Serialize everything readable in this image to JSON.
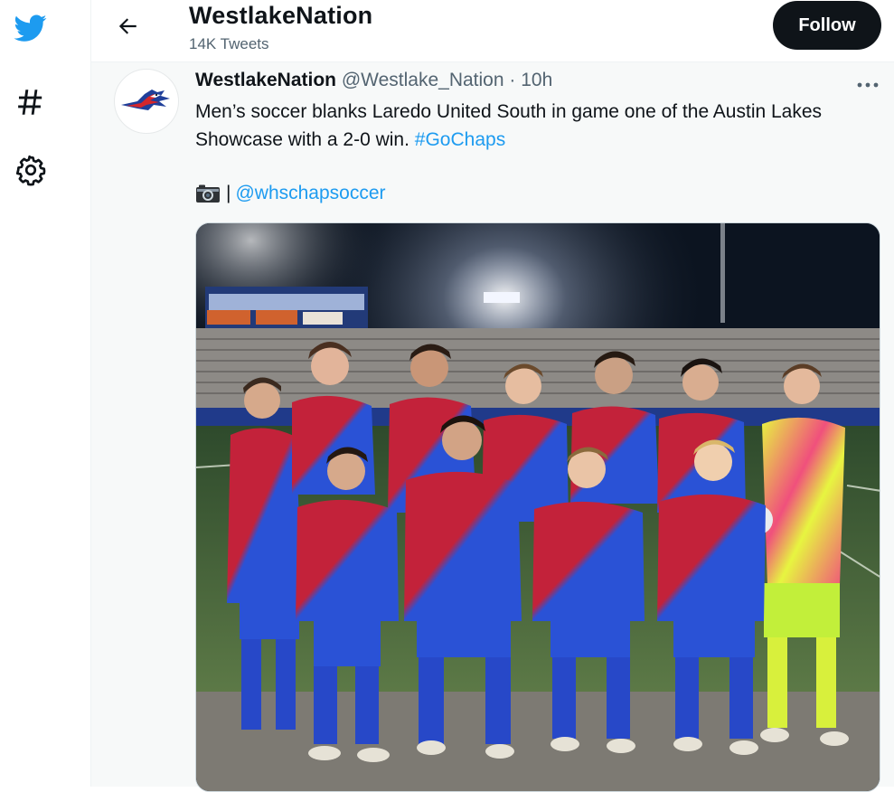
{
  "nav": {
    "items": [
      {
        "icon": "twitter-bird-icon",
        "color": "#1d9bf0"
      },
      {
        "icon": "hashtag-icon"
      },
      {
        "icon": "gear-icon"
      }
    ]
  },
  "header": {
    "title": "WestlakeNation",
    "subtitle": "14K Tweets",
    "follow_label": "Follow"
  },
  "tweet": {
    "author_name": "WestlakeNation",
    "handle": "@Westlake_Nation",
    "separator": "·",
    "time": "10h",
    "text": "Men’s soccer blanks Laredo United South in game one of the Austin Lakes Showcase with a 2-0 win.",
    "hashtag": "#GoChaps",
    "credit_separator": "|",
    "credit_mention": "@whschapsoccer"
  },
  "colors": {
    "accent": "#1d9bf0",
    "text": "#0f1419",
    "muted": "#536471"
  }
}
